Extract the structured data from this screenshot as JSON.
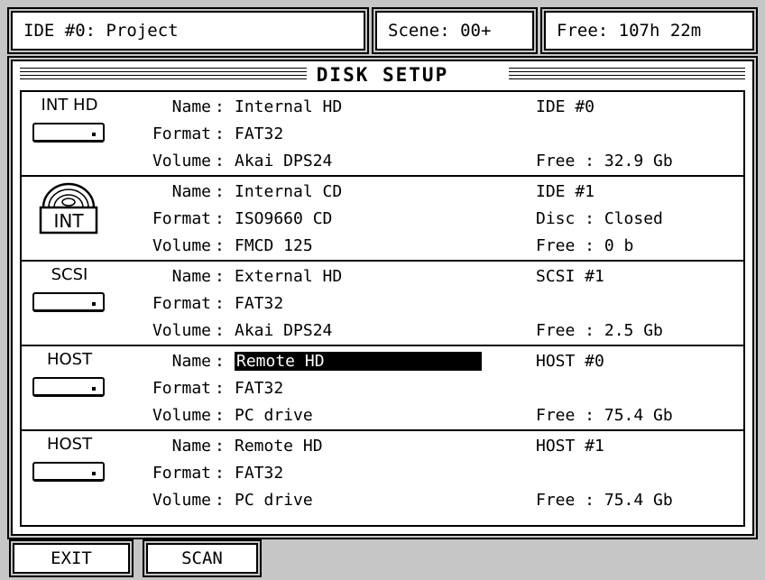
{
  "header": {
    "project": "IDE #0: Project",
    "scene": "Scene: 00+",
    "free": "Free: 107h 22m"
  },
  "panel": {
    "title": "DISK SETUP"
  },
  "labels": {
    "name": "Name",
    "format": "Format",
    "volume": "Volume",
    "colon": ":"
  },
  "drives": [
    {
      "type": "INT HD",
      "icon": "hard-drive-icon",
      "name": "Internal HD",
      "format": "FAT32",
      "volume": "Akai DPS24",
      "id": "IDE #0",
      "status": "",
      "free": "Free : 32.9 Gb"
    },
    {
      "type": "INT",
      "icon": "cd-drive-icon",
      "name": "Internal CD",
      "format": "ISO9660 CD",
      "volume": "FMCD 125",
      "id": "IDE #1",
      "status": "Disc : Closed",
      "free": "Free : 0 b"
    },
    {
      "type": "SCSI",
      "icon": "hard-drive-icon",
      "name": "External HD",
      "format": "FAT32",
      "volume": "Akai DPS24",
      "id": "SCSI #1",
      "status": "",
      "free": "Free : 2.5 Gb"
    },
    {
      "type": "HOST",
      "icon": "hard-drive-icon",
      "name": "Remote HD",
      "format": "FAT32",
      "volume": "PC drive",
      "id": "HOST #0",
      "status": "",
      "free": "Free : 75.4 Gb",
      "selected": true
    },
    {
      "type": "HOST",
      "icon": "hard-drive-icon",
      "name": "Remote HD",
      "format": "FAT32",
      "volume": "PC drive",
      "id": "HOST #1",
      "status": "",
      "free": "Free : 75.4 Gb"
    }
  ],
  "buttons": {
    "exit": "EXIT",
    "scan": "SCAN"
  }
}
